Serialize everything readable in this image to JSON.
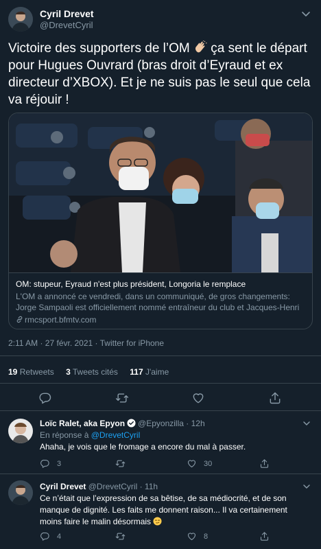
{
  "tweet": {
    "author_name": "Cyril Drevet",
    "author_handle": "@DrevetCyril",
    "text_part1": "Victoire des supporters de l’OM",
    "text_part2": "ça sent le départ pour Hugues Ouvrard (bras droit d’Eyraud et ex directeur d’XBOX). Et je ne suis pas le seul que cela va réjouir !",
    "timestamp": "2:11 AM · 27 févr. 2021 · Twitter for iPhone"
  },
  "card": {
    "title": "OM: stupeur, Eyraud n'est plus président, Longoria le remplace",
    "description": "L'OM a annoncé ce vendredi, dans un communiqué, de gros changements: Jorge Sampaoli est officiellement nommé entraîneur du club et Jacques-Henri Eyraud ...",
    "domain": "rmcsport.bfmtv.com"
  },
  "stats": {
    "retweets_count": "19",
    "retweets_label": "Retweets",
    "quotes_count": "3",
    "quotes_label": "Tweets cités",
    "likes_count": "117",
    "likes_label": "J'aime"
  },
  "replies": [
    {
      "name": "Loïc Ralet, aka Epyon",
      "handle": "@Epyonzilla",
      "time": "· 12h",
      "reply_prefix": "En réponse à",
      "reply_to": "@DrevetCyril",
      "text": "Ahaha, je vois que le fromage a encore du mal à passer.",
      "replies_count": "3",
      "retweets_count": "",
      "likes_count": "30"
    },
    {
      "name": "Cyril Drevet",
      "handle": "@DrevetCyril",
      "time": "· 11h",
      "text": "Ce n’était que l’expression de sa bêtise, de sa médiocrité, et de son manque de dignité. Les faits me donnent raison... Il va certainement moins faire le malin désormais",
      "replies_count": "4",
      "retweets_count": "",
      "likes_count": "8"
    }
  ],
  "icons": {
    "reply": "reply-icon",
    "retweet": "retweet-icon",
    "like": "heart-icon",
    "share": "share-icon"
  },
  "colors": {
    "background": "#15202b",
    "muted": "#8899a6",
    "accent": "#1da1f2",
    "border": "#38444d"
  }
}
